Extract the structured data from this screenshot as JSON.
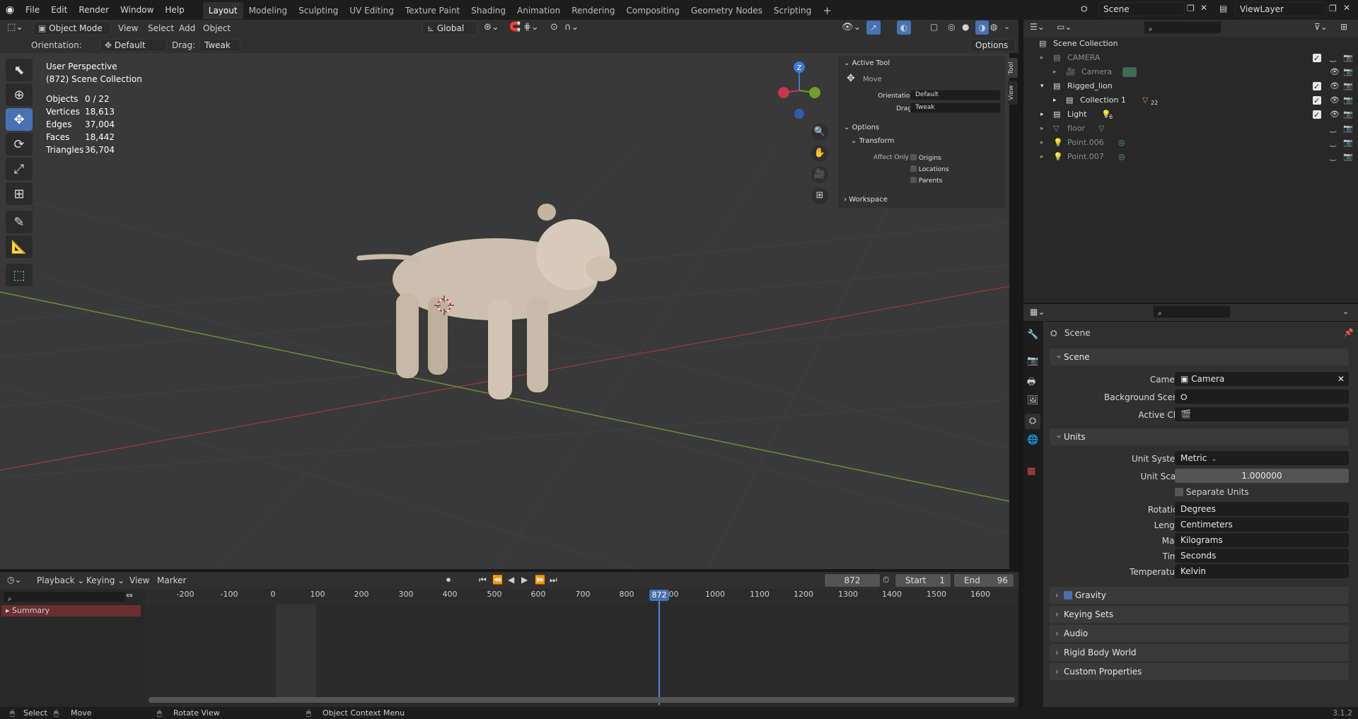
{
  "topbar": {
    "menu": [
      "File",
      "Edit",
      "Render",
      "Window",
      "Help"
    ],
    "workspaces": [
      "Layout",
      "Modeling",
      "Sculpting",
      "UV Editing",
      "Texture Paint",
      "Shading",
      "Animation",
      "Rendering",
      "Compositing",
      "Geometry Nodes",
      "Scripting"
    ],
    "active_workspace": "Layout",
    "add_tab": "+",
    "scene_name": "Scene",
    "view_layer": "ViewLayer"
  },
  "viewport_header": {
    "mode": "Object Mode",
    "menus": [
      "View",
      "Select",
      "Add",
      "Object"
    ],
    "transform_orientation": "Global",
    "orientation_label": "Orientation:",
    "orientation_value": "Default",
    "drag_label": "Drag:",
    "drag_value": "Tweak",
    "options": "Options"
  },
  "viewport": {
    "perspective": "User Perspective",
    "collection": "(872) Scene Collection",
    "stats": [
      {
        "label": "Objects",
        "value": "0 / 22"
      },
      {
        "label": "Vertices",
        "value": "18,613"
      },
      {
        "label": "Edges",
        "value": "37,004"
      },
      {
        "label": "Faces",
        "value": "18,442"
      },
      {
        "label": "Triangles",
        "value": "36,704"
      }
    ],
    "gizmo_axis": "Z",
    "tools": [
      "select-box",
      "cursor",
      "move",
      "rotate",
      "scale",
      "transform",
      "annotate",
      "measure",
      "add-cube"
    ],
    "active_tool": "move"
  },
  "npanel": {
    "active_tool_title": "Active Tool",
    "tool_name": "Move",
    "orientation_label": "Orientation",
    "orientation_value": "Default",
    "drag_label": "Drag:",
    "drag_value": "Tweak",
    "options_title": "Options",
    "transform_title": "Transform",
    "affect_only": "Affect Only",
    "checkboxes": [
      "Origins",
      "Locations",
      "Parents"
    ],
    "workspace_title": "Workspace",
    "tabs": [
      "Tool",
      "View"
    ]
  },
  "outliner": {
    "search_placeholder": "",
    "root": "Scene Collection",
    "rows": [
      {
        "name": "CAMERA",
        "dim": true
      },
      {
        "name": "Camera",
        "dim": true
      },
      {
        "name": "Rigged_lion",
        "dim": false
      },
      {
        "name": "Collection 1",
        "dim": false,
        "badge": "22"
      },
      {
        "name": "Light",
        "dim": false,
        "badge": "6"
      },
      {
        "name": "floor",
        "dim": true
      },
      {
        "name": "Point.006",
        "dim": true
      },
      {
        "name": "Point.007",
        "dim": true
      }
    ]
  },
  "properties": {
    "context": "Scene",
    "scene_section": "Scene",
    "camera_label": "Camera",
    "camera_value": "Camera",
    "bg_scene_label": "Background Scene",
    "active_clip_label": "Active Clip",
    "units_section": "Units",
    "unit_system_label": "Unit System",
    "unit_system_value": "Metric",
    "unit_scale_label": "Unit Scale",
    "unit_scale_value": "1.000000",
    "separate_units": "Separate Units",
    "rotation_label": "Rotation",
    "rotation_value": "Degrees",
    "length_label": "Length",
    "length_value": "Centimeters",
    "mass_label": "Mass",
    "mass_value": "Kilograms",
    "time_label": "Time",
    "time_value": "Seconds",
    "temperature_label": "Temperature",
    "temperature_value": "Kelvin",
    "collapsed_sections": [
      "Gravity",
      "Keying Sets",
      "Audio",
      "Rigid Body World",
      "Custom Properties"
    ]
  },
  "timeline": {
    "menus": [
      "Playback",
      "Keying",
      "View",
      "Marker"
    ],
    "current_frame": "872",
    "start_label": "Start",
    "start_value": "1",
    "end_label": "End",
    "end_value": "96",
    "summary": "Summary",
    "ticks": [
      "-200",
      "-100",
      "0",
      "100",
      "200",
      "300",
      "400",
      "500",
      "600",
      "700",
      "800",
      "900",
      "1000",
      "1100",
      "1200",
      "1300",
      "1400",
      "1500",
      "1600"
    ],
    "playhead_label": "872"
  },
  "statusbar": {
    "select": "Select",
    "move": "Move",
    "rotate_view": "Rotate View",
    "context_menu": "Object Context Menu",
    "version": "3.1.2"
  }
}
